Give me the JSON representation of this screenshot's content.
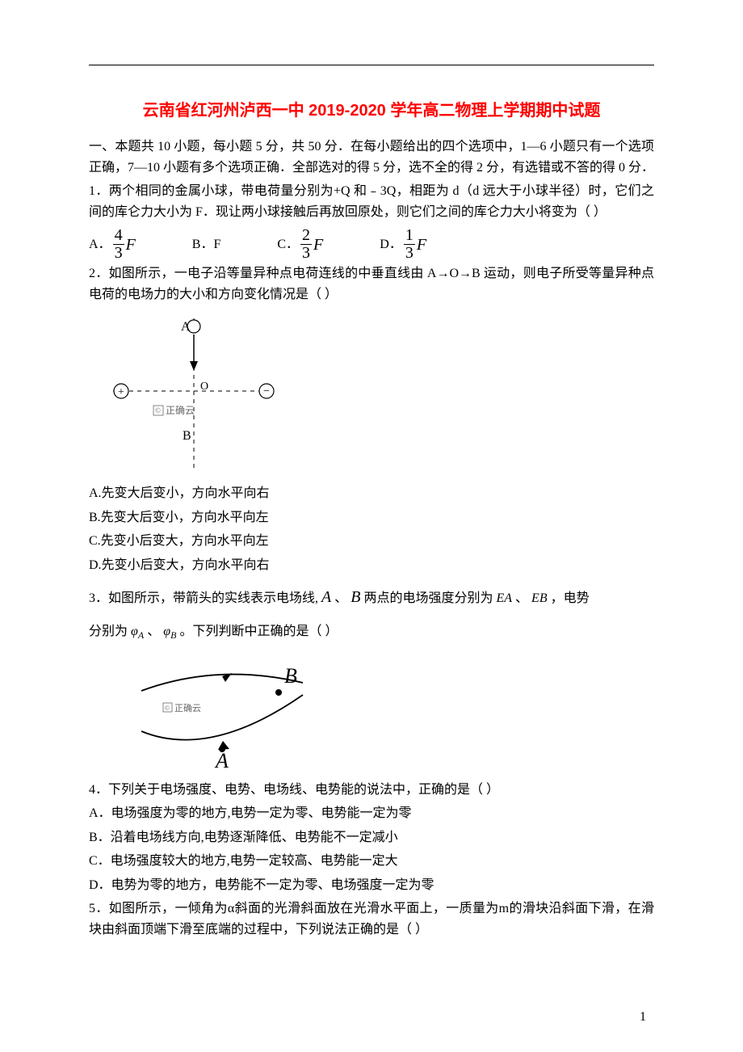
{
  "title": "云南省红河州泸西一中 2019-2020 学年高二物理上学期期中试题",
  "instructions": "一、本题共 10 小题，每小题 5 分，共 50 分．在每小题给出的四个选项中，1—6 小题只有一个选项正确，7—10 小题有多个选项正确．全部选对的得 5 分，选不全的得 2 分，有选错或不答的得 0 分．",
  "q1": {
    "stem": "1．两个相同的金属小球，带电荷量分别为+Q 和﹣3Q，相距为 d（d 远大于小球半径）时，它们之间的库仑力大小为 F．现让两小球接触后再放回原处，则它们之间的库仑力大小将变为（  ）",
    "A": "A．",
    "A_num": "4",
    "A_den": "3",
    "B": "B．F",
    "C": "C．",
    "C_num": "2",
    "C_den": "3",
    "D": "D．",
    "D_num": "1",
    "D_den": "3"
  },
  "q2": {
    "stem": "2．如图所示，一电子沿等量异种点电荷连线的中垂直线由 A→O→B 运动，则电子所受等量异种点电荷的电场力的大小和方向变化情况是（  ）",
    "watermark": "正确云",
    "A": "A.先变大后变小，方向水平向右",
    "B": "B.先变大后变小，方向水平向左",
    "C": "C.先变小后变大，方向水平向左",
    "D": "D.先变小后变大，方向水平向右"
  },
  "q3": {
    "stem_a": "3．如图所示，带箭头的实线表示电场线,",
    "stem_mid": "、",
    "stem_b": " 两点的电场强度分别为 ",
    "EA": "EA",
    "stem_c": "、 ",
    "EB": "EB",
    "stem_d": " ，电势",
    "stem2_a": "分别为",
    "phiA": "φ",
    "phiAsub": "A",
    "sep": " 、",
    "phiB": "φ",
    "phiBsub": "B",
    "stem2_b": " 。下列判断中正确的是（  ）",
    "watermark": "正确云",
    "A_label": "A",
    "B_label": "B"
  },
  "q4": {
    "stem": "4．下列关于电场强度、电势、电场线、电势能的说法中，正确的是（  ）",
    "A": "A．电场强度为零的地方,电势一定为零、电势能一定为零",
    "B": "B．沿着电场线方向,电势逐渐降低、电势能不一定减小",
    "C": "C．电场强度较大的地方,电势一定较高、电势能一定大",
    "D": "D．电势为零的地方，电势能不一定为零、电场强度一定为零"
  },
  "q5": {
    "stem": "5．如图所示，一倾角为α斜面的光滑斜面放在光滑水平面上，一质量为m的滑块沿斜面下滑，在滑块由斜面顶端下滑至底端的过程中，下列说法正确的是（  ）"
  },
  "pagenum": "1",
  "labels": {
    "A": "A",
    "B": "B",
    "O": "O",
    "plus": "+",
    "minus": "−"
  }
}
